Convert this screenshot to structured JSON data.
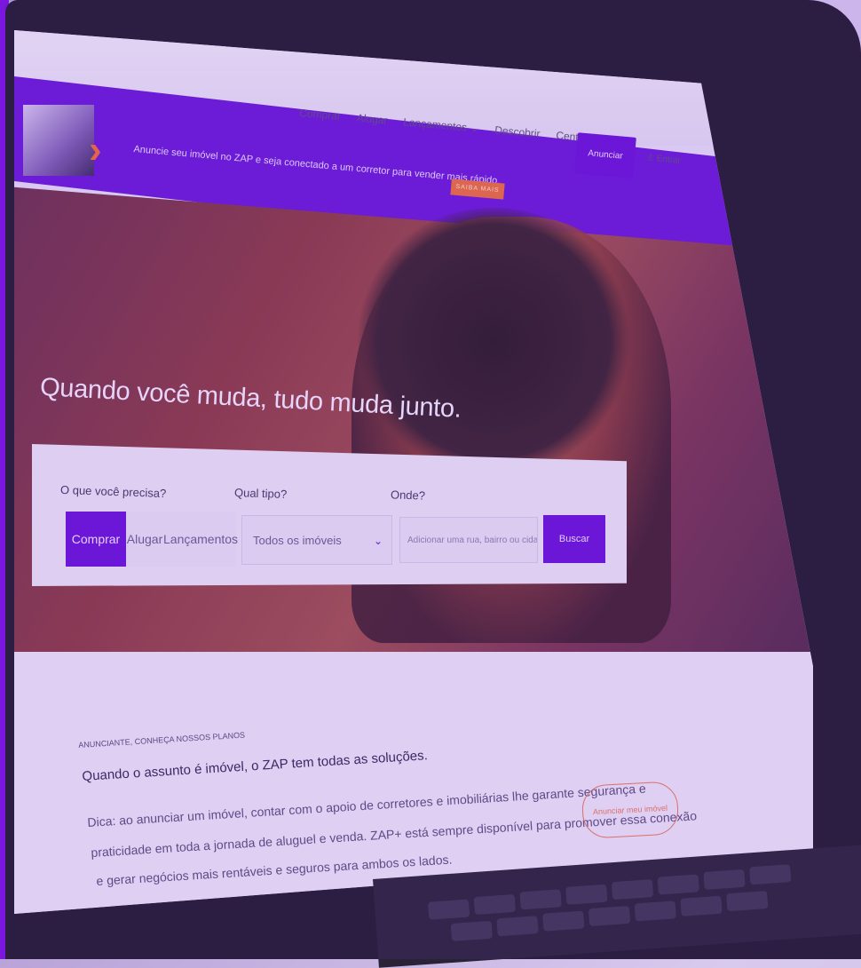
{
  "nav": {
    "links": [
      "Comprar",
      "Alugar",
      "Lançamentos ⌄",
      "Descobrir",
      "Central de ajuda"
    ],
    "announce_button": "Anunciar",
    "login": "Entrar"
  },
  "banner": {
    "text": "Anuncie seu imóvel no ZAP e seja conectado a um corretor para vender mais rápido.",
    "cta": "SAIBA MAIS"
  },
  "hero": {
    "title": "Quando você muda, tudo muda junto."
  },
  "search": {
    "label_need": "O que você precisa?",
    "label_type": "Qual tipo?",
    "label_where": "Onde?",
    "tabs": [
      "Comprar",
      "Alugar",
      "Lançamentos"
    ],
    "type_value": "Todos os imóveis",
    "where_placeholder": "Adicionar uma rua, bairro ou cidade",
    "button": "Buscar"
  },
  "advertiser": {
    "eyebrow": "ANUNCIANTE, CONHEÇA NOSSOS PLANOS",
    "heading": "Quando o assunto é imóvel, o ZAP tem todas as soluções.",
    "body": [
      "Dica: ao anunciar um imóvel, contar com o apoio de corretores e imobiliárias lhe garante segurança e",
      "praticidade em toda a jornada de aluguel e venda. ZAP+ está sempre disponível para promover essa conexão",
      "e gerar negócios mais rentáveis e seguros para ambos os lados."
    ],
    "button": "Anunciar meu imóvel"
  },
  "colors": {
    "brand_purple": "#6a12d9",
    "accent_orange": "#ea6d3d"
  }
}
